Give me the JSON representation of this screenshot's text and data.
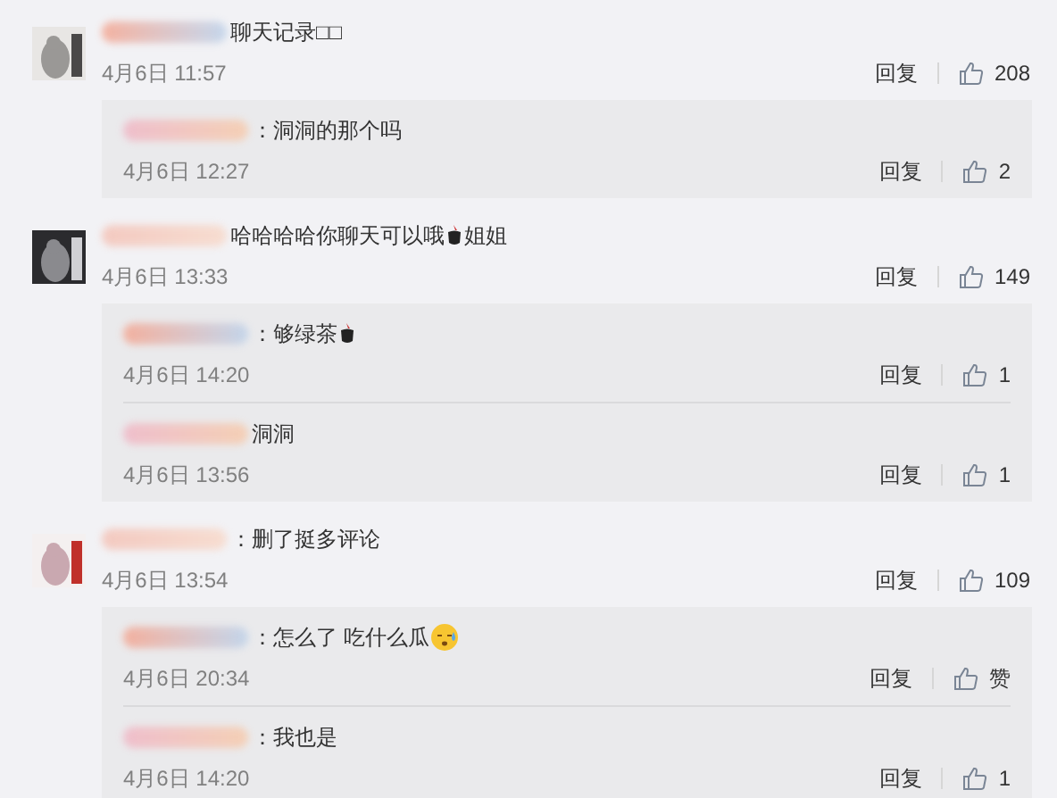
{
  "comments": [
    {
      "segments": [
        {
          "kind": "text",
          "text": "聊天记录□□"
        }
      ],
      "time": "4月6日 11:57",
      "reply_label": "回复",
      "likes": "208",
      "replies": [
        {
          "segments": [
            {
              "kind": "text",
              "text": "：洞洞的那个吗"
            }
          ],
          "time": "4月6日 12:27",
          "reply_label": "回复",
          "likes": "2"
        }
      ]
    },
    {
      "segments": [
        {
          "kind": "text",
          "text": "哈哈哈哈你聊天可以哦"
        },
        {
          "kind": "cup"
        },
        {
          "kind": "text",
          "text": "姐姐"
        }
      ],
      "time": "4月6日 13:33",
      "reply_label": "回复",
      "likes": "149",
      "replies": [
        {
          "segments": [
            {
              "kind": "text",
              "text": "：够绿茶"
            },
            {
              "kind": "cup"
            }
          ],
          "time": "4月6日 14:20",
          "reply_label": "回复",
          "likes": "1"
        },
        {
          "segments": [
            {
              "kind": "text",
              "text": "洞洞"
            }
          ],
          "time": "4月6日 13:56",
          "reply_label": "回复",
          "likes": "1"
        }
      ]
    },
    {
      "segments": [
        {
          "kind": "text",
          "text": "：删了挺多评论"
        }
      ],
      "time": "4月6日 13:54",
      "reply_label": "回复",
      "likes": "109",
      "replies": [
        {
          "segments": [
            {
              "kind": "text",
              "text": "：怎么了 吃什么瓜"
            },
            {
              "kind": "sweat"
            }
          ],
          "time": "4月6日 20:34",
          "reply_label": "回复",
          "likes": "赞"
        },
        {
          "segments": [
            {
              "kind": "text",
              "text": "：我也是"
            }
          ],
          "time": "4月6日 14:20",
          "reply_label": "回复",
          "likes": "1"
        }
      ]
    }
  ]
}
